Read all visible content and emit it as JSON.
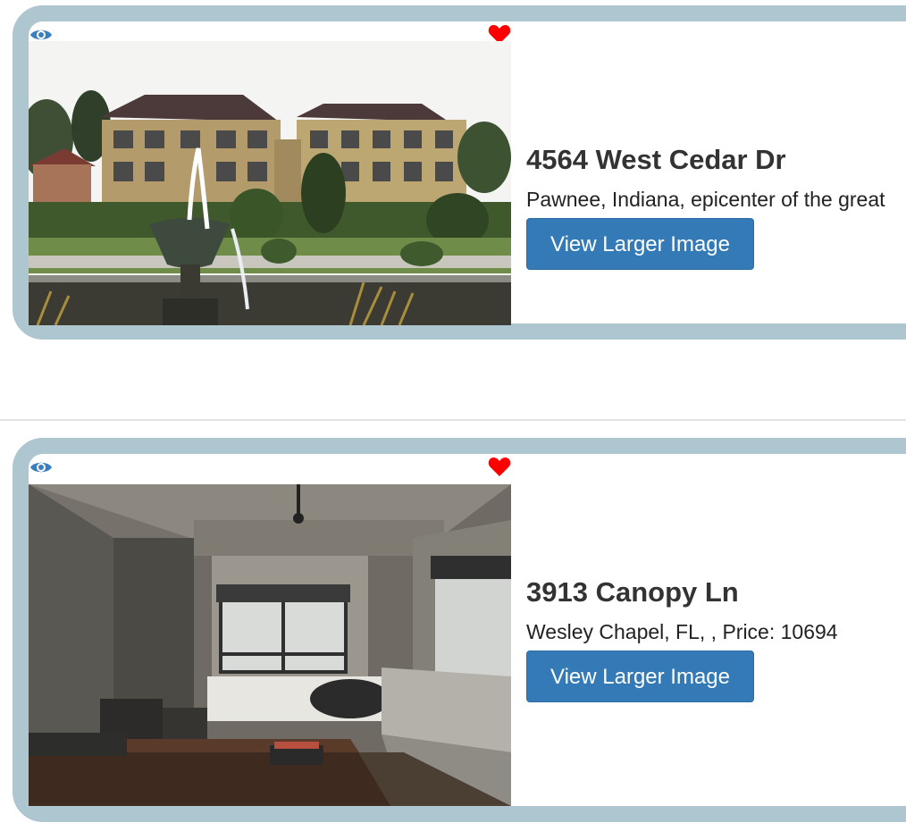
{
  "colors": {
    "card_border": "#adc6d0",
    "button_bg": "#337ab7",
    "eye_icon": "#3a7ebf",
    "heart_icon": "#ff0000"
  },
  "listings": [
    {
      "address": "4564 West Cedar Dr",
      "description": "Pawnee, Indiana, epicenter of the great",
      "button_label": "View Larger Image",
      "icons": [
        "eye-icon",
        "heart-icon"
      ]
    },
    {
      "address": "3913 Canopy Ln",
      "description": "Wesley Chapel, FL, , Price: 10694",
      "button_label": "View Larger Image",
      "icons": [
        "eye-icon",
        "heart-icon"
      ]
    }
  ]
}
